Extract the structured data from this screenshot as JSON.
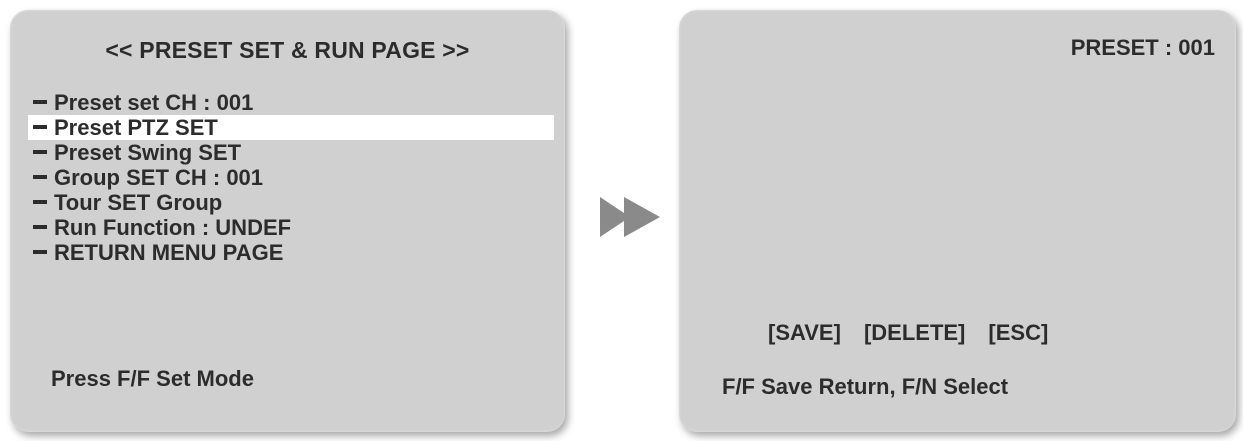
{
  "left_screen": {
    "title": "<< PRESET SET & RUN PAGE >>",
    "menu_items": [
      {
        "label": "Preset set CH : 001"
      },
      {
        "label": "Preset PTZ SET"
      },
      {
        "label": "Preset Swing SET"
      },
      {
        "label": "Group SET CH : 001"
      },
      {
        "label": "Tour SET Group"
      },
      {
        "label": "Run Function : UNDEF"
      },
      {
        "label": "RETURN MENU PAGE"
      }
    ],
    "selected_index": 1,
    "footer": "Press F/F Set Mode"
  },
  "transition_icon": "double-arrow-right-icon",
  "right_screen": {
    "preset_label": "PRESET : 001",
    "buttons": {
      "save": "[SAVE]",
      "delete": "[DELETE]",
      "esc": "[ESC]"
    },
    "footer": "F/F Save Return, F/N Select"
  },
  "colors": {
    "screen_bg": "#d0d0d0",
    "text": "#2c2c2c",
    "highlight": "#ffffff",
    "arrow": "#8a8a8a"
  }
}
